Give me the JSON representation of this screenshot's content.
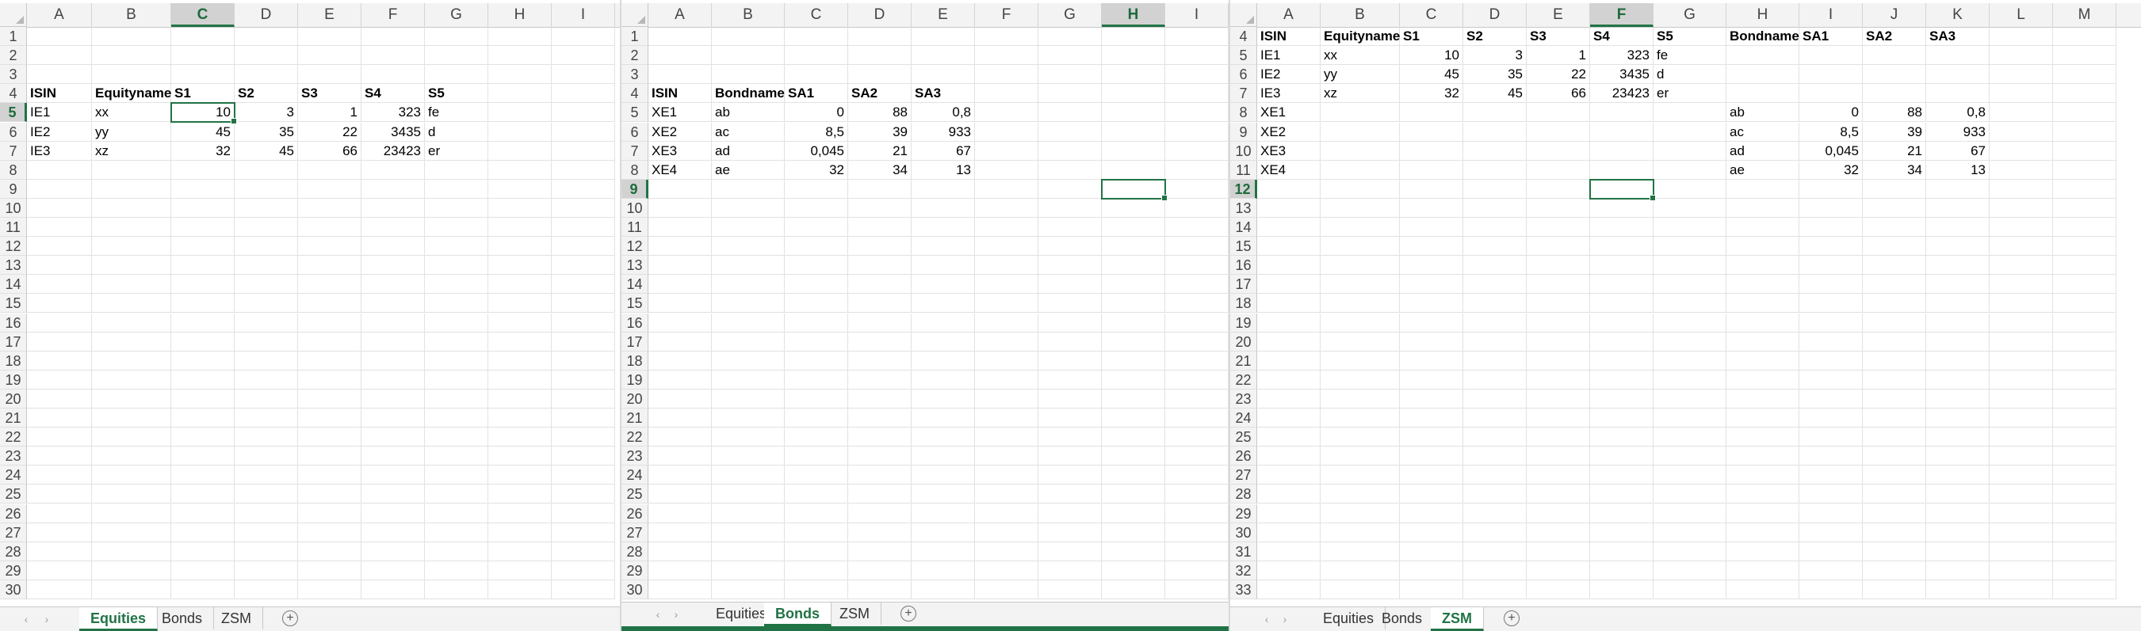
{
  "colors": {
    "accent": "#217346",
    "header_bg": "#f3f3f3"
  },
  "windows": [
    {
      "name": "equities",
      "columns": [
        "A",
        "B",
        "C",
        "D",
        "E",
        "F",
        "G",
        "H",
        "I"
      ],
      "selected_col": "C",
      "first_row": 1,
      "row_count": 30,
      "selected_row": 5,
      "selection": "C5",
      "cells": {
        "A4": "ISIN",
        "B4": "Equityname",
        "C4": "S1",
        "D4": "S2",
        "E4": "S3",
        "F4": "S4",
        "G4": "S5",
        "A5": "IE1",
        "B5": "xx",
        "C5": "10",
        "D5": "3",
        "E5": "1",
        "F5": "323",
        "G5": "fe",
        "A6": "IE2",
        "B6": "yy",
        "C6": "45",
        "D6": "35",
        "E6": "22",
        "F6": "3435",
        "G6": "d",
        "A7": "IE3",
        "B7": "xz",
        "C7": "32",
        "D7": "45",
        "E7": "66",
        "F7": "23423",
        "G7": "er"
      },
      "bold_rows": [
        4
      ],
      "tabs": [
        "Equities",
        "Bonds",
        "ZSM"
      ],
      "active_tab": 0
    },
    {
      "name": "bonds",
      "columns": [
        "A",
        "B",
        "C",
        "D",
        "E",
        "F",
        "G",
        "H",
        "I"
      ],
      "selected_col": "H",
      "first_row": 1,
      "row_count": 30,
      "selected_row": 9,
      "selection": "H9",
      "cells": {
        "A4": "ISIN",
        "B4": "Bondname",
        "C4": "SA1",
        "D4": "SA2",
        "E4": "SA3",
        "A5": "XE1",
        "B5": "ab",
        "C5": "0",
        "D5": "88",
        "E5": "0,8",
        "A6": "XE2",
        "B6": "ac",
        "C6": "8,5",
        "D6": "39",
        "E6": "933",
        "A7": "XE3",
        "B7": "ad",
        "C7": "0,045",
        "D7": "21",
        "E7": "67",
        "A8": "XE4",
        "B8": "ae",
        "C8": "32",
        "D8": "34",
        "E8": "13"
      },
      "bold_rows": [
        4
      ],
      "tabs": [
        "Equities",
        "Bonds",
        "ZSM"
      ],
      "active_tab": 1
    },
    {
      "name": "zsm",
      "columns": [
        "A",
        "B",
        "C",
        "D",
        "E",
        "F",
        "G",
        "H",
        "I",
        "J",
        "K",
        "L",
        "M"
      ],
      "selected_col": "F",
      "first_row": 4,
      "row_count": 30,
      "selected_row": 12,
      "selection": "F12",
      "cells": {
        "A4": "ISIN",
        "B4": "Equityname",
        "C4": "S1",
        "D4": "S2",
        "E4": "S3",
        "F4": "S4",
        "G4": "S5",
        "H4": "Bondname",
        "I4": "SA1",
        "J4": "SA2",
        "K4": "SA3",
        "A5": "IE1",
        "B5": "xx",
        "C5": "10",
        "D5": "3",
        "E5": "1",
        "F5": "323",
        "G5": "fe",
        "A6": "IE2",
        "B6": "yy",
        "C6": "45",
        "D6": "35",
        "E6": "22",
        "F6": "3435",
        "G6": "d",
        "A7": "IE3",
        "B7": "xz",
        "C7": "32",
        "D7": "45",
        "E7": "66",
        "F7": "23423",
        "G7": "er",
        "A8": "XE1",
        "H8": "ab",
        "I8": "0",
        "J8": "88",
        "K8": "0,8",
        "A9": "XE2",
        "H9": "ac",
        "I9": "8,5",
        "J9": "39",
        "K9": "933",
        "A10": "XE3",
        "H10": "ad",
        "I10": "0,045",
        "J10": "21",
        "K10": "67",
        "A11": "XE4",
        "H11": "ae",
        "I11": "32",
        "J11": "34",
        "K11": "13"
      },
      "bold_rows": [
        4
      ],
      "tabs": [
        "Equities",
        "Bonds",
        "ZSM"
      ],
      "active_tab": 2
    }
  ]
}
